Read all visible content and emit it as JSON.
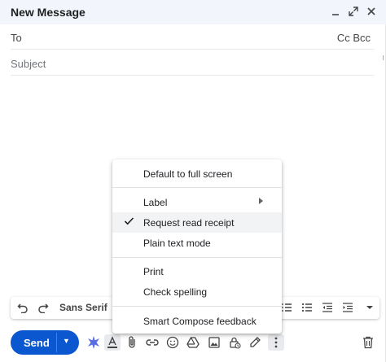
{
  "window": {
    "title": "New Message",
    "controls": [
      "minimize-icon",
      "popout-icon",
      "close-icon"
    ]
  },
  "fields": {
    "to_label": "To",
    "cc_bcc": "Cc Bcc",
    "subject_placeholder": "Subject"
  },
  "menu": {
    "items": [
      {
        "label": "Default to full screen"
      },
      {
        "label": "Label"
      },
      {
        "label": "Request read receipt",
        "checked": true
      },
      {
        "label": "Plain text mode"
      },
      {
        "label": "Print"
      },
      {
        "label": "Check spelling"
      },
      {
        "label": "Smart Compose feedback"
      }
    ]
  },
  "format_bar": {
    "font": "Sans Serif",
    "icons": [
      "undo-icon",
      "redo-icon",
      "numbered-list-icon",
      "bulleted-list-icon",
      "indent-less-icon",
      "indent-more-icon",
      "more-formatting-icon"
    ]
  },
  "bottom_bar": {
    "send_label": "Send",
    "icons": [
      "gemini-icon",
      "formatting-options-icon",
      "attach-icon",
      "link-icon",
      "emoji-icon",
      "drive-icon",
      "photo-icon",
      "confidential-icon",
      "signature-icon",
      "more-options-icon",
      "discard-icon"
    ]
  },
  "colors": {
    "send_button": "#0b57d0",
    "title_bar": "#f2f6fc"
  }
}
